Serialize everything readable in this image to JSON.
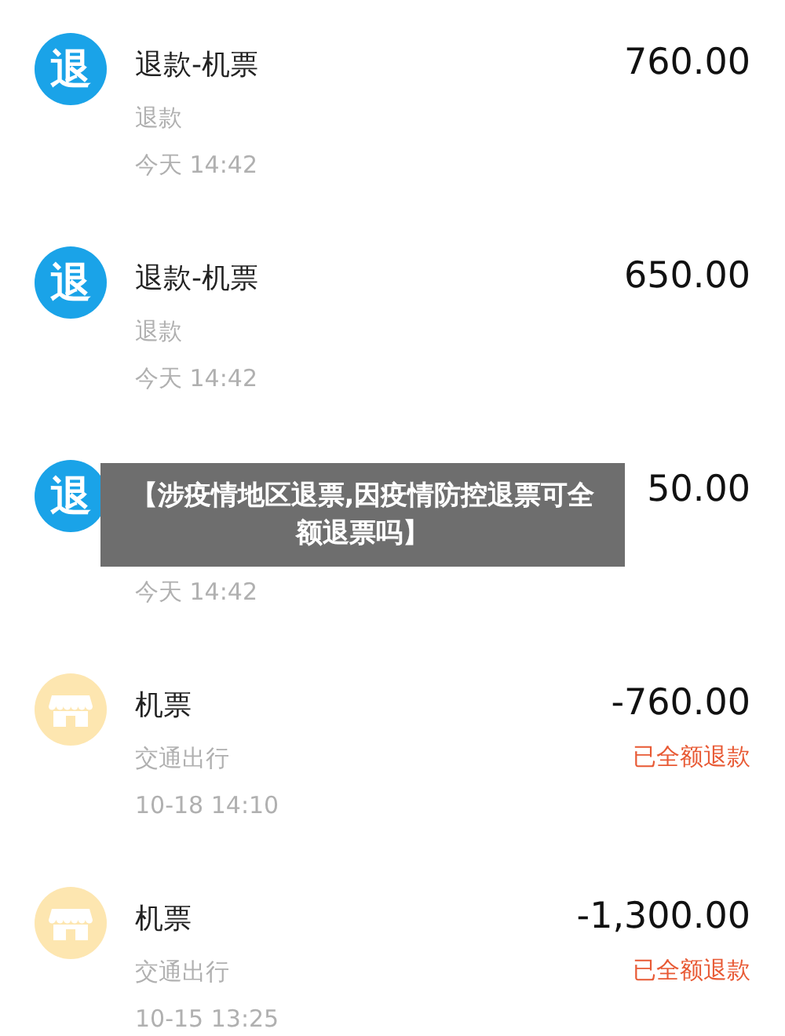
{
  "transactions": [
    {
      "kind": "refund",
      "icon_text": "退",
      "title": "退款-机票",
      "amount": "760.00",
      "subtitle": "退款",
      "time": "今天  14:42"
    },
    {
      "kind": "refund",
      "icon_text": "退",
      "title": "退款-机票",
      "amount": "650.00",
      "subtitle": "退款",
      "time": "今天  14:42"
    },
    {
      "kind": "refund",
      "icon_text": "退",
      "amount": "50.00",
      "time": "今天  14:42"
    },
    {
      "kind": "ticket",
      "title": "机票",
      "amount": "-760.00",
      "subtitle": "交通出行",
      "status": "已全额退款",
      "time": "10-18  14:10"
    },
    {
      "kind": "ticket",
      "title": "机票",
      "amount": "-1,300.00",
      "subtitle": "交通出行",
      "status": "已全额退款",
      "time": "10-15  13:25"
    }
  ],
  "caption_overlay": "【涉疫情地区退票,因疫情防控退票可全额退票吗】"
}
